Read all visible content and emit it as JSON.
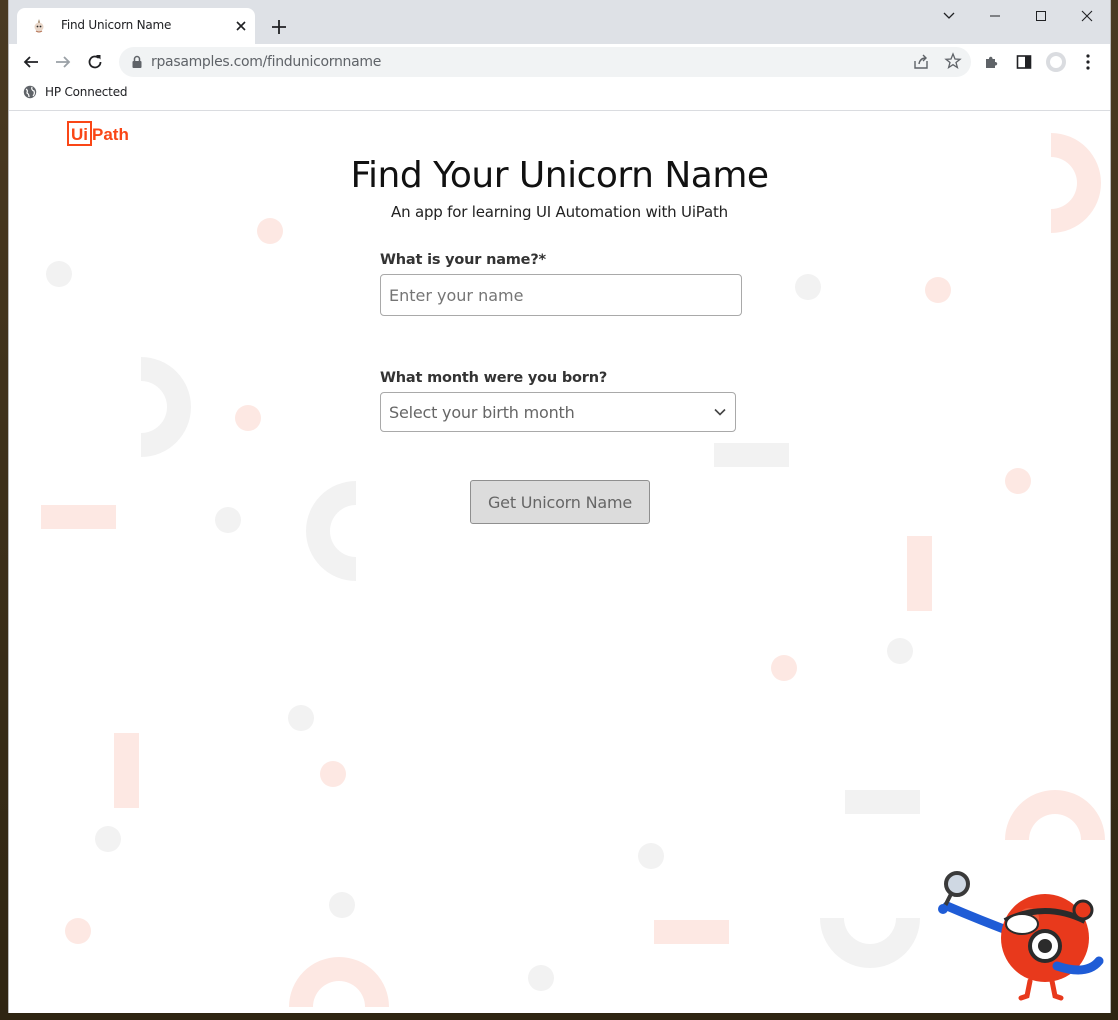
{
  "browser": {
    "tab_title": "Find Unicorn Name",
    "url": "rpasamples.com/findunicornname",
    "bookmark_label": "HP Connected"
  },
  "page": {
    "logo_text_left": "Ui",
    "logo_text_right": "Path",
    "title": "Find Your Unicorn Name",
    "subtitle": "An app for learning UI Automation with UiPath",
    "name_label": "What is your name?*",
    "name_placeholder": "Enter your name",
    "name_value": "",
    "month_label": "What month were you born?",
    "month_selected": "Select your birth month",
    "button_label": "Get Unicorn Name"
  },
  "colors": {
    "brand": "#fa4616",
    "accent_blue": "#1f5cd6",
    "deco_pink": "#fde8e3",
    "deco_gray": "#f2f2f2"
  },
  "icons": [
    "unicorn-favicon",
    "close-icon",
    "plus-icon",
    "chevron-down-icon",
    "minimize-icon",
    "maximize-icon",
    "close-window-icon",
    "back-arrow-icon",
    "forward-arrow-icon",
    "reload-icon",
    "lock-icon",
    "share-icon",
    "star-icon",
    "extensions-icon",
    "side-panel-icon",
    "profile-icon",
    "more-menu-icon",
    "globe-icon",
    "dropdown-chevron-icon",
    "mascot-magnifier"
  ]
}
